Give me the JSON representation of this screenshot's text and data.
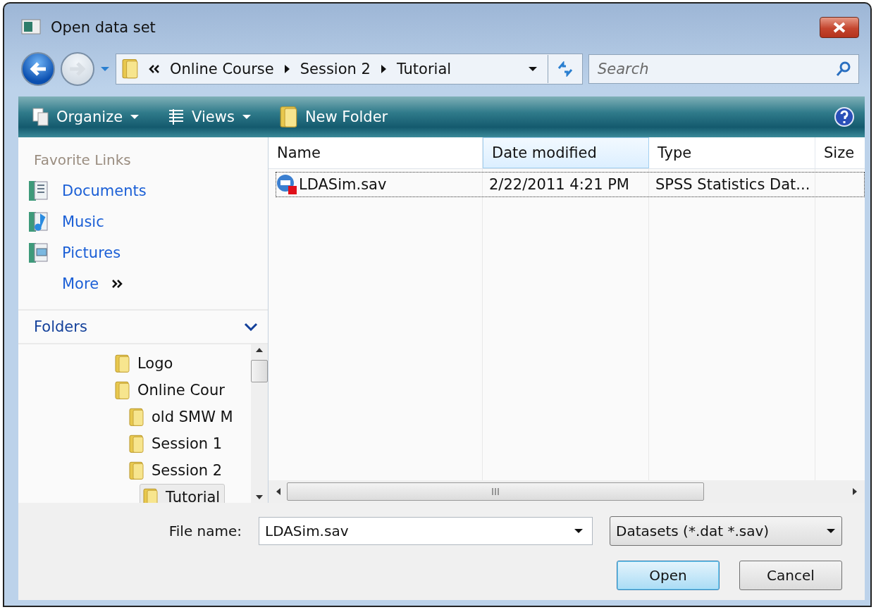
{
  "window": {
    "title": "Open data set"
  },
  "address_bar": {
    "crumbs": [
      "Online Course",
      "Session 2",
      "Tutorial"
    ]
  },
  "search": {
    "placeholder": "Search"
  },
  "toolbar": {
    "items": [
      {
        "label": "Organize",
        "kind": "menu"
      },
      {
        "label": "Views",
        "kind": "menu"
      },
      {
        "label": "New Folder",
        "kind": "button"
      }
    ]
  },
  "favorite_links": {
    "title": "Favorite Links",
    "items": [
      {
        "label": "Documents",
        "kind": "documents"
      },
      {
        "label": "Music",
        "kind": "music"
      },
      {
        "label": "Pictures",
        "kind": "pictures"
      }
    ],
    "more": "More"
  },
  "folders": {
    "title": "Folders",
    "items": [
      {
        "label": "Logo",
        "selected": false
      },
      {
        "label": "Online Cour",
        "selected": false,
        "children": [
          {
            "label": "old SMW M",
            "selected": false
          },
          {
            "label": "Session 1",
            "selected": false
          },
          {
            "label": "Session 2",
            "selected": false,
            "children": [
              {
                "label": "Tutorial",
                "selected": true
              }
            ]
          }
        ]
      }
    ]
  },
  "table": {
    "columns": [
      {
        "label": "Name",
        "sorted": false
      },
      {
        "label": "Date modified",
        "sorted": true
      },
      {
        "label": "Type",
        "sorted": false
      },
      {
        "label": "Size",
        "sorted": false
      }
    ],
    "rows": [
      {
        "name": "LDASim.sav",
        "date_modified": "2/22/2011 4:21 PM",
        "type": "SPSS Statistics Dat...",
        "selected": true
      }
    ]
  },
  "file_name": {
    "label": "File name:",
    "value": "LDASim.sav"
  },
  "file_type": {
    "value": "Datasets (*.dat *.sav)"
  },
  "buttons": [
    {
      "label": "Open",
      "default": true
    },
    {
      "label": "Cancel",
      "default": false
    }
  ]
}
